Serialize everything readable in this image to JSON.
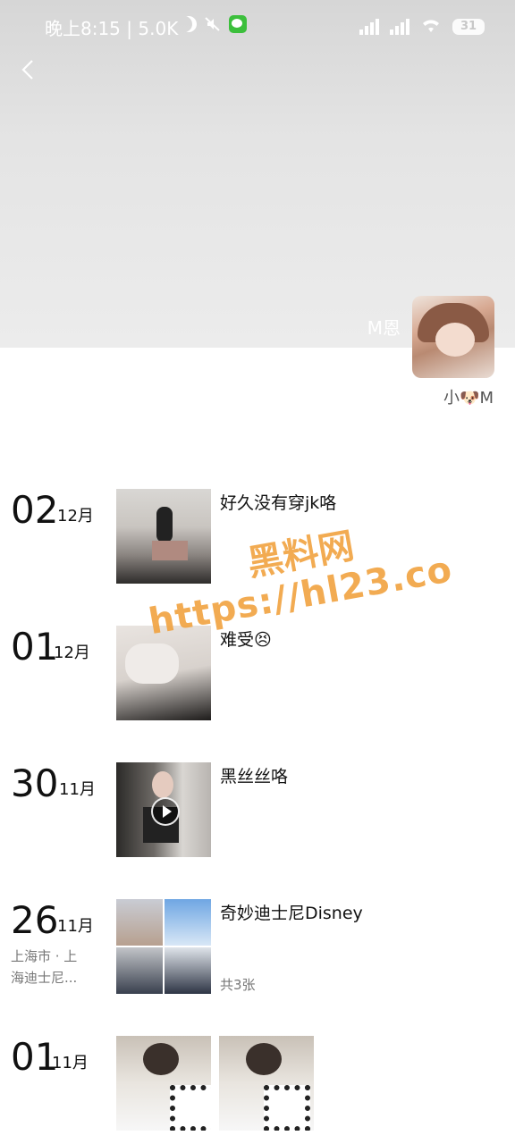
{
  "status_bar": {
    "time": "晚上8:15",
    "separator": "|",
    "net_speed": "5.0K",
    "battery": "31"
  },
  "profile": {
    "cover_name": "M恩",
    "signature": "小🐶M"
  },
  "posts": [
    {
      "day": "02",
      "month": "12月",
      "text": "好久没有穿jk咯",
      "location": "",
      "count": ""
    },
    {
      "day": "01",
      "month": "12月",
      "text": "难受😣",
      "location": "",
      "count": ""
    },
    {
      "day": "30",
      "month": "11月",
      "text": "黑丝丝咯",
      "location": "",
      "count": ""
    },
    {
      "day": "26",
      "month": "11月",
      "text": "奇妙迪士尼Disney",
      "location_line1": "上海市 · 上",
      "location_line2": "海迪士尼...",
      "count": "共3张"
    },
    {
      "day": "01",
      "month": "11月",
      "text": "",
      "location": "",
      "count": ""
    }
  ],
  "watermark": {
    "line1": "黑料网",
    "line2": "https://hl23.co"
  },
  "icons": {
    "back": "chevron-left-icon",
    "play": "play-icon"
  }
}
